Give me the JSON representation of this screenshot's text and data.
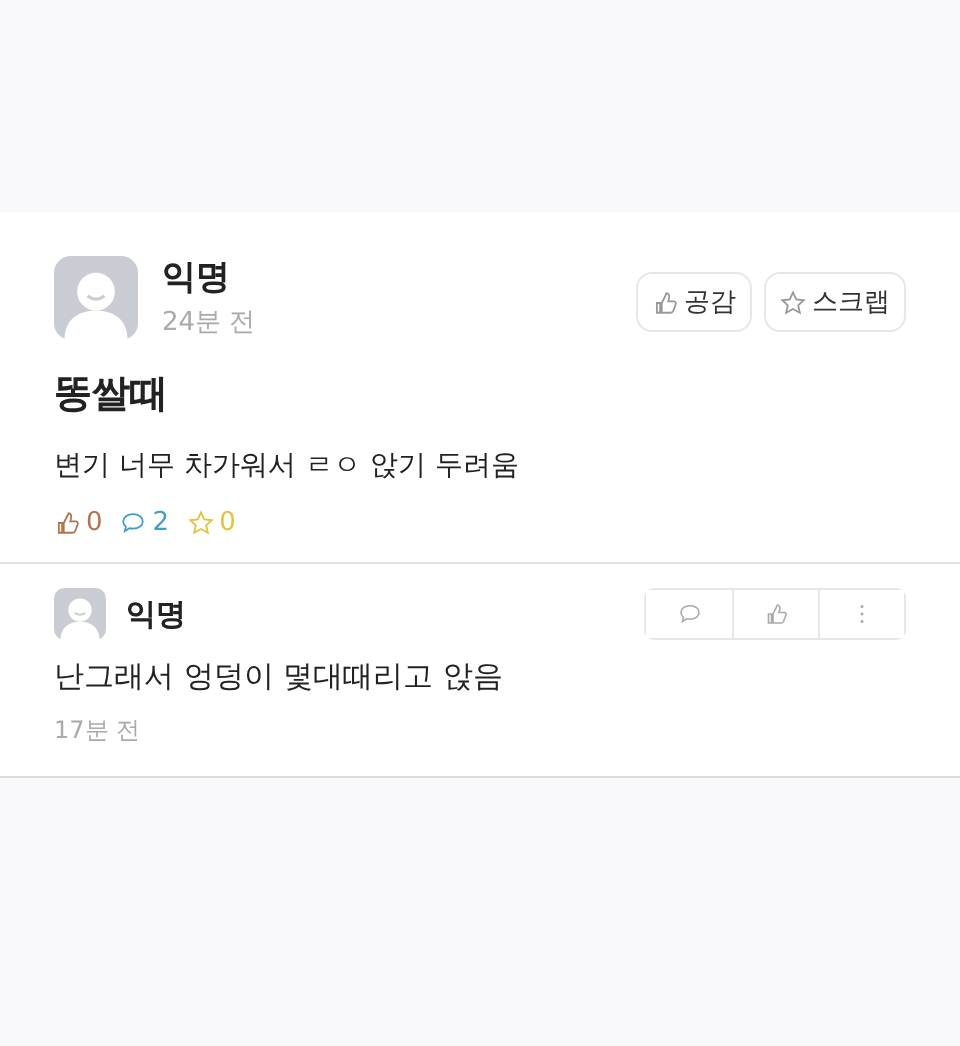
{
  "post": {
    "author": "익명",
    "time": "24분 전",
    "buttons": [
      {
        "kind": "like",
        "label": "공감"
      },
      {
        "kind": "scrap",
        "label": "스크랩"
      }
    ],
    "title": "똥쌀때",
    "body": "변기 너무 차가워서 ㄹㅇ 앉기 두려움",
    "counts": [
      {
        "kind": "like",
        "value": "0",
        "color": "#b5744e"
      },
      {
        "kind": "comment",
        "value": "2",
        "color": "#3f9fc7"
      },
      {
        "kind": "scrap",
        "value": "0",
        "color": "#e5c23c"
      }
    ]
  },
  "comment": {
    "author": "익명",
    "text": "난그래서 엉덩이 몇대때리고 앉음",
    "time": "17분 전",
    "actions": [
      {
        "kind": "comment"
      },
      {
        "kind": "like"
      },
      {
        "kind": "more"
      }
    ]
  }
}
